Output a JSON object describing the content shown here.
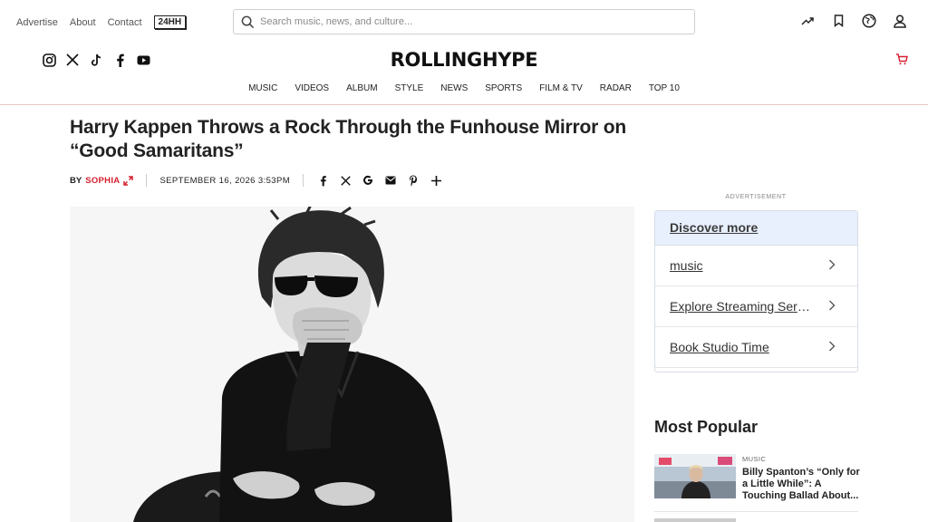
{
  "header": {
    "links": [
      "Advertise",
      "About",
      "Contact"
    ],
    "badge": "24HH",
    "search_placeholder": "Search music, news, and culture...",
    "logo": "ROLLINGHYPE",
    "nav": [
      "MUSIC",
      "VIDEOS",
      "ALBUM",
      "STYLE",
      "NEWS",
      "SPORTS",
      "FILM & TV",
      "RADAR",
      "TOP 10"
    ]
  },
  "article": {
    "title": "Harry Kappen Throws a Rock Through the Funhouse Mirror on “Good Samaritans”",
    "by_label": "BY",
    "author": "SOPHIA",
    "date": "SEPTEMBER 16, 2026 3:53PM"
  },
  "sidebar": {
    "ad_label": "ADVERTISEMENT",
    "discover_title": "Discover more",
    "discover_items": [
      "music",
      "Explore Streaming Services",
      "Book Studio Time"
    ],
    "popular_title": "Most Popular",
    "popular_items": [
      {
        "category": "MUSIC",
        "title": "Billy Spanton’s “Only for a Little While”: A Touching Ballad About..."
      }
    ]
  },
  "colors": {
    "accent": "#d6202f",
    "discover_bg": "#e8f0fe"
  },
  "icons": {
    "top": [
      "trending-icon",
      "bookmark-icon",
      "globe-icon",
      "user-icon"
    ],
    "social": [
      "instagram-icon",
      "x-icon",
      "tiktok-icon",
      "facebook-icon",
      "youtube-icon"
    ],
    "share": [
      "facebook-icon",
      "x-icon",
      "google-icon",
      "email-icon",
      "pinterest-icon",
      "plus-icon"
    ]
  }
}
